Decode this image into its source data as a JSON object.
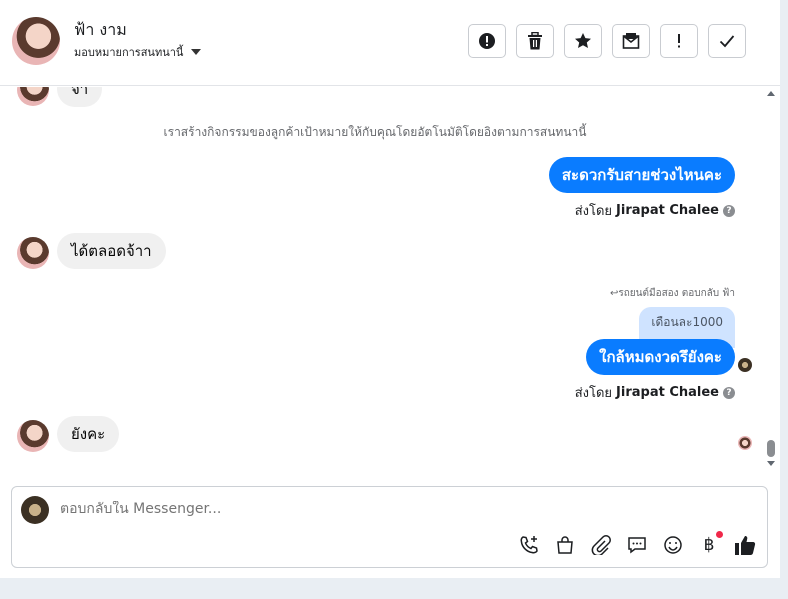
{
  "header": {
    "contact_name": "ฟ้า งาม",
    "assign_label": "มอบหมายการสนทนานี้",
    "actions": [
      {
        "name": "spam-button",
        "icon": "alert-circle-icon"
      },
      {
        "name": "delete-button",
        "icon": "trash-icon"
      },
      {
        "name": "star-button",
        "icon": "star-icon"
      },
      {
        "name": "mark-unread-button",
        "icon": "envelope-icon"
      },
      {
        "name": "follow-up-button",
        "icon": "exclamation-icon"
      },
      {
        "name": "done-button",
        "icon": "check-icon"
      }
    ]
  },
  "messages": {
    "m1_partial": "จ้า",
    "system_note": "เราสร้างกิจกรรมของลูกค้าเป้าหมายให้กับคุณโดยอัตโนมัติโดยอิงตามการสนทนานี้",
    "m2_out": "สะดวกรับสายช่วงไหนคะ",
    "sent_by_prefix": "ส่งโดย",
    "sent_by_name": "Jirapat Chalee",
    "m3_in": "ได้ตลอดจ้าา",
    "reply_header": "รถยนต์มือสอง ตอบกลับ ฟ้า",
    "quoted": "เดือนละ1000",
    "m4_out": "ใกล้หมดงวดรึยังคะ",
    "m5_in": "ยังคะ"
  },
  "composer": {
    "placeholder": "ตอบกลับใน Messenger...",
    "tools": [
      "phone-add-icon",
      "bag-icon",
      "paperclip-icon",
      "chat-icon",
      "emoji-icon",
      "baht-icon",
      "thumbs-up-icon"
    ]
  }
}
